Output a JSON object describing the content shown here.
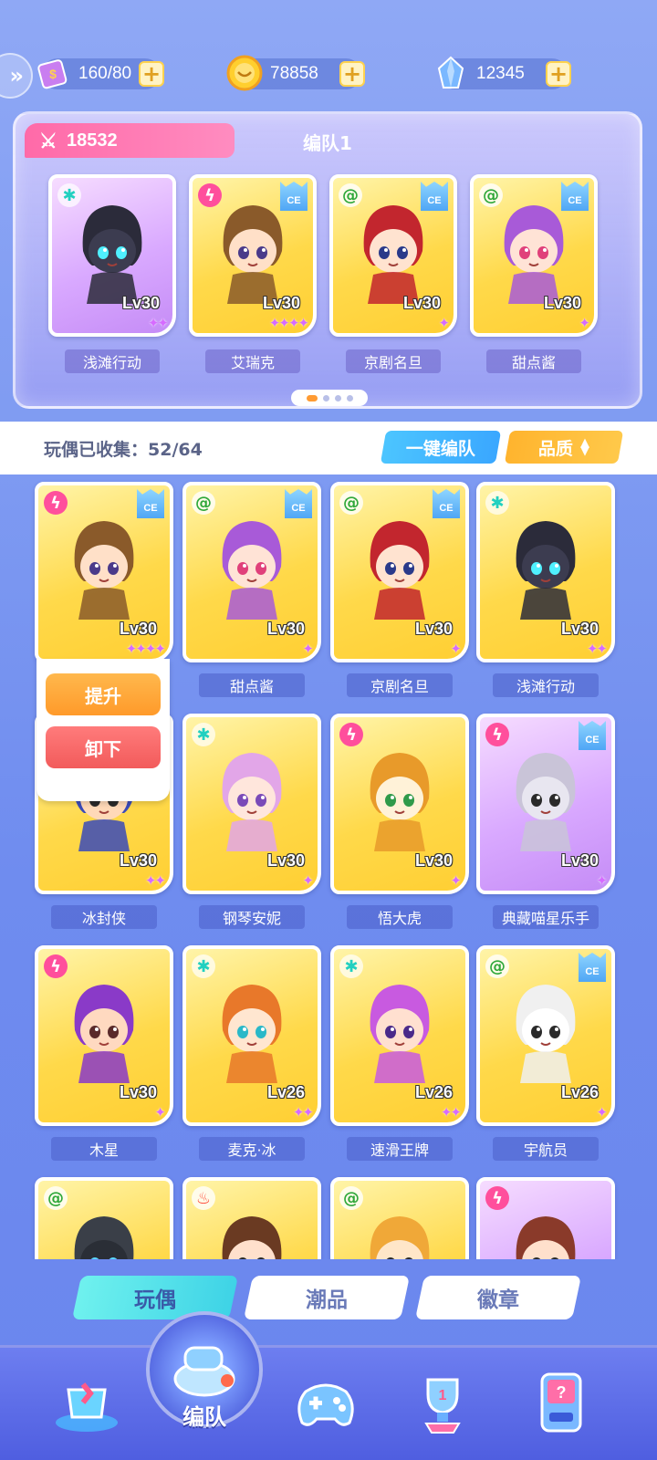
{
  "resources": {
    "stamina": "160/80",
    "coins": "78858",
    "gems": "12345"
  },
  "team": {
    "power": "18532",
    "title": "编队1",
    "members": [
      {
        "name": "浅滩行动",
        "level": "Lv30",
        "element": "ice",
        "ce": false,
        "stars": "✦✦",
        "bg": "p",
        "hair": "#2b2b3a",
        "face": "#3c3c50",
        "eye": "#4ff0ff"
      },
      {
        "name": "艾瑞克",
        "level": "Lv30",
        "element": "bolt",
        "ce": true,
        "stars": "✦✦✦✦",
        "bg": "y",
        "hair": "#8a5a2a",
        "face": "#ffe0c8",
        "eye": "#4a3a8a"
      },
      {
        "name": "京剧名旦",
        "level": "Lv30",
        "element": "swirl",
        "ce": true,
        "stars": "✦",
        "bg": "y",
        "hair": "#c2262e",
        "face": "#ffe3d0",
        "eye": "#2a3a8a"
      },
      {
        "name": "甜点酱",
        "level": "Lv30",
        "element": "swirl",
        "ce": true,
        "stars": "✦",
        "bg": "y",
        "hair": "#a85ad8",
        "face": "#ffe3d6",
        "eye": "#e0407a"
      }
    ]
  },
  "collection": {
    "label": "玩偶已收集：52/64",
    "auto_button": "一键编队",
    "quality_button": "品质"
  },
  "popup": {
    "upgrade": "提升",
    "unload": "卸下"
  },
  "grid": [
    {
      "name": "",
      "level": "Lv30",
      "element": "bolt",
      "ce": true,
      "stars": "✦✦✦✦",
      "bg": "y",
      "hair": "#8a5a2a",
      "face": "#ffe0c8",
      "eye": "#4a3a8a"
    },
    {
      "name": "甜点酱",
      "level": "Lv30",
      "element": "swirl",
      "ce": true,
      "stars": "✦",
      "bg": "y",
      "hair": "#a85ad8",
      "face": "#ffe3d6",
      "eye": "#e0407a"
    },
    {
      "name": "京剧名旦",
      "level": "Lv30",
      "element": "swirl",
      "ce": true,
      "stars": "✦",
      "bg": "y",
      "hair": "#c2262e",
      "face": "#ffe3d0",
      "eye": "#2a3a8a"
    },
    {
      "name": "浅滩行动",
      "level": "Lv30",
      "element": "ice",
      "ce": false,
      "stars": "✦✦",
      "bg": "y",
      "hair": "#2b2b3a",
      "face": "#3c3c50",
      "eye": "#4ff0ff"
    },
    {
      "name": "冰封侠",
      "level": "Lv30",
      "element": "bolt",
      "ce": false,
      "stars": "✦✦",
      "bg": "y",
      "hair": "#3a4ab8",
      "face": "#ffd9b8",
      "eye": "#2a2a2a"
    },
    {
      "name": "钢琴安妮",
      "level": "Lv30",
      "element": "ice",
      "ce": false,
      "stars": "✦",
      "bg": "y",
      "hair": "#e2a6e8",
      "face": "#ffe6dc",
      "eye": "#7a4ab8"
    },
    {
      "name": "悟大虎",
      "level": "Lv30",
      "element": "bolt",
      "ce": false,
      "stars": "✦",
      "bg": "y",
      "hair": "#e89a2a",
      "face": "#fff2d8",
      "eye": "#2f9a4a"
    },
    {
      "name": "典藏喵星乐手",
      "level": "Lv30",
      "element": "bolt",
      "ce": true,
      "stars": "✦",
      "bg": "p",
      "hair": "#c9c4d8",
      "face": "#e8e6f0",
      "eye": "#2a2a2a"
    },
    {
      "name": "木星",
      "level": "Lv30",
      "element": "bolt",
      "ce": false,
      "stars": "✦",
      "bg": "y",
      "hair": "#8a3ac8",
      "face": "#ffd9c0",
      "eye": "#5a2a2a"
    },
    {
      "name": "麦克·冰",
      "level": "Lv26",
      "element": "ice",
      "ce": false,
      "stars": "✦✦",
      "bg": "y",
      "hair": "#e8782a",
      "face": "#ffe6d0",
      "eye": "#2ab8c8"
    },
    {
      "name": "速滑王牌",
      "level": "Lv26",
      "element": "ice",
      "ce": false,
      "stars": "✦✦",
      "bg": "y",
      "hair": "#c85ae0",
      "face": "#ffe0d0",
      "eye": "#4a2a8a"
    },
    {
      "name": "宇航员",
      "level": "Lv26",
      "element": "swirl",
      "ce": true,
      "stars": "✦",
      "bg": "y",
      "hair": "#f0f0f0",
      "face": "#ffffff",
      "eye": "#2a2a2a"
    },
    {
      "name": "",
      "level": "",
      "element": "swirl",
      "ce": false,
      "stars": "",
      "bg": "y",
      "hair": "#3a3f48",
      "face": "#2a2e36",
      "eye": "#5ad8ff"
    },
    {
      "name": "",
      "level": "",
      "element": "fire",
      "ce": false,
      "stars": "",
      "bg": "y",
      "hair": "#6a3a22",
      "face": "#ffe0cc",
      "eye": "#2a2a2a"
    },
    {
      "name": "",
      "level": "",
      "element": "swirl",
      "ce": false,
      "stars": "",
      "bg": "y",
      "hair": "#f0a838",
      "face": "#ffe6c8",
      "eye": "#2a2a2a"
    },
    {
      "name": "",
      "level": "",
      "element": "bolt",
      "ce": false,
      "stars": "",
      "bg": "p",
      "hair": "#8a3a2a",
      "face": "#ffe0cc",
      "eye": "#2a2a2a"
    }
  ],
  "tabs": [
    "玩偶",
    "潮品",
    "徽章"
  ],
  "nav": {
    "active_label": "编队",
    "items": [
      "shop-icon",
      "team-whistle-icon",
      "gamepad-icon",
      "trophy-icon",
      "vending-machine-icon"
    ]
  },
  "ce_label": "CE",
  "elements": {
    "ice": "✱",
    "bolt": "ϟ",
    "swirl": "@",
    "fire": "♨"
  }
}
